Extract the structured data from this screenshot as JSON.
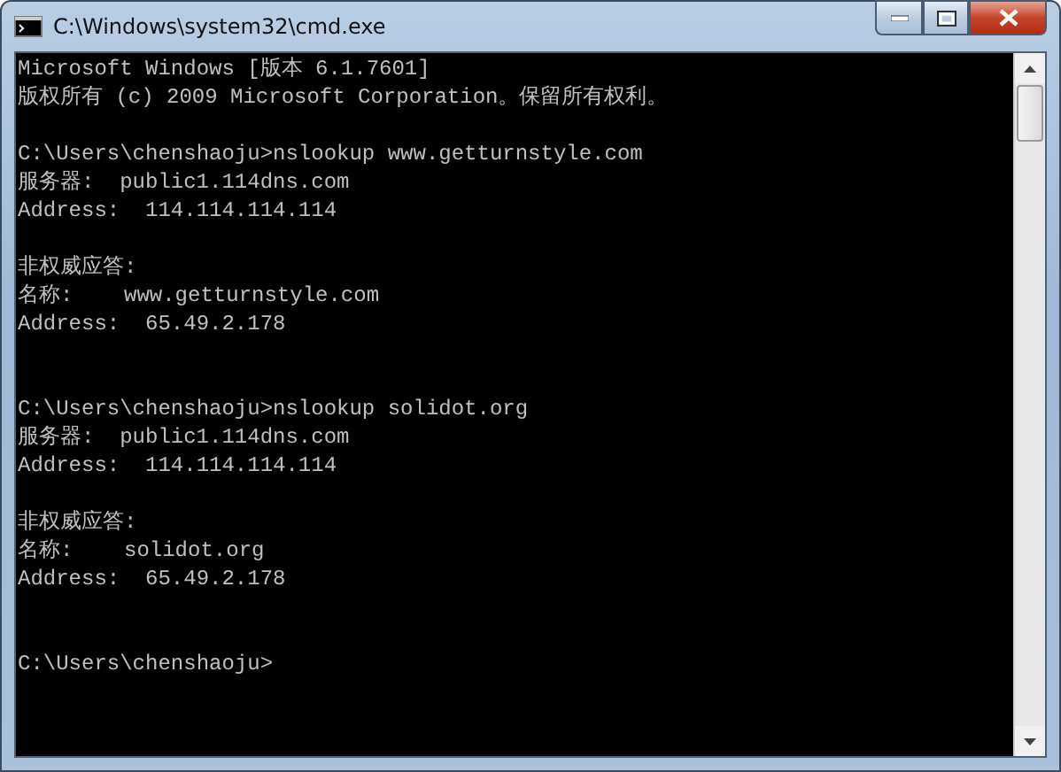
{
  "window": {
    "title": "C:\\Windows\\system32\\cmd.exe"
  },
  "console": {
    "lines": [
      {
        "kind": "text",
        "text": "Microsoft Windows [版本 6.1.7601]"
      },
      {
        "kind": "text",
        "text": "版权所有 (c) 2009 Microsoft Corporation。保留所有权利。"
      },
      {
        "kind": "blank"
      },
      {
        "kind": "text",
        "text": "C:\\Users\\chenshaoju>nslookup www.getturnstyle.com"
      },
      {
        "kind": "text",
        "text": "服务器:  public1.114dns.com"
      },
      {
        "kind": "text",
        "text": "Address:  114.114.114.114"
      },
      {
        "kind": "blank"
      },
      {
        "kind": "text",
        "text": "非权威应答:"
      },
      {
        "kind": "text",
        "text": "名称:    www.getturnstyle.com"
      },
      {
        "kind": "text",
        "text": "Address:  65.49.2.178"
      },
      {
        "kind": "blank"
      },
      {
        "kind": "blank"
      },
      {
        "kind": "text",
        "text": "C:\\Users\\chenshaoju>nslookup solidot.org"
      },
      {
        "kind": "text",
        "text": "服务器:  public1.114dns.com"
      },
      {
        "kind": "text",
        "text": "Address:  114.114.114.114"
      },
      {
        "kind": "blank"
      },
      {
        "kind": "text",
        "text": "非权威应答:"
      },
      {
        "kind": "text",
        "text": "名称:    solidot.org"
      },
      {
        "kind": "text",
        "text": "Address:  65.49.2.178"
      },
      {
        "kind": "blank"
      },
      {
        "kind": "blank"
      },
      {
        "kind": "text",
        "text": "C:\\Users\\chenshaoju>"
      }
    ]
  }
}
